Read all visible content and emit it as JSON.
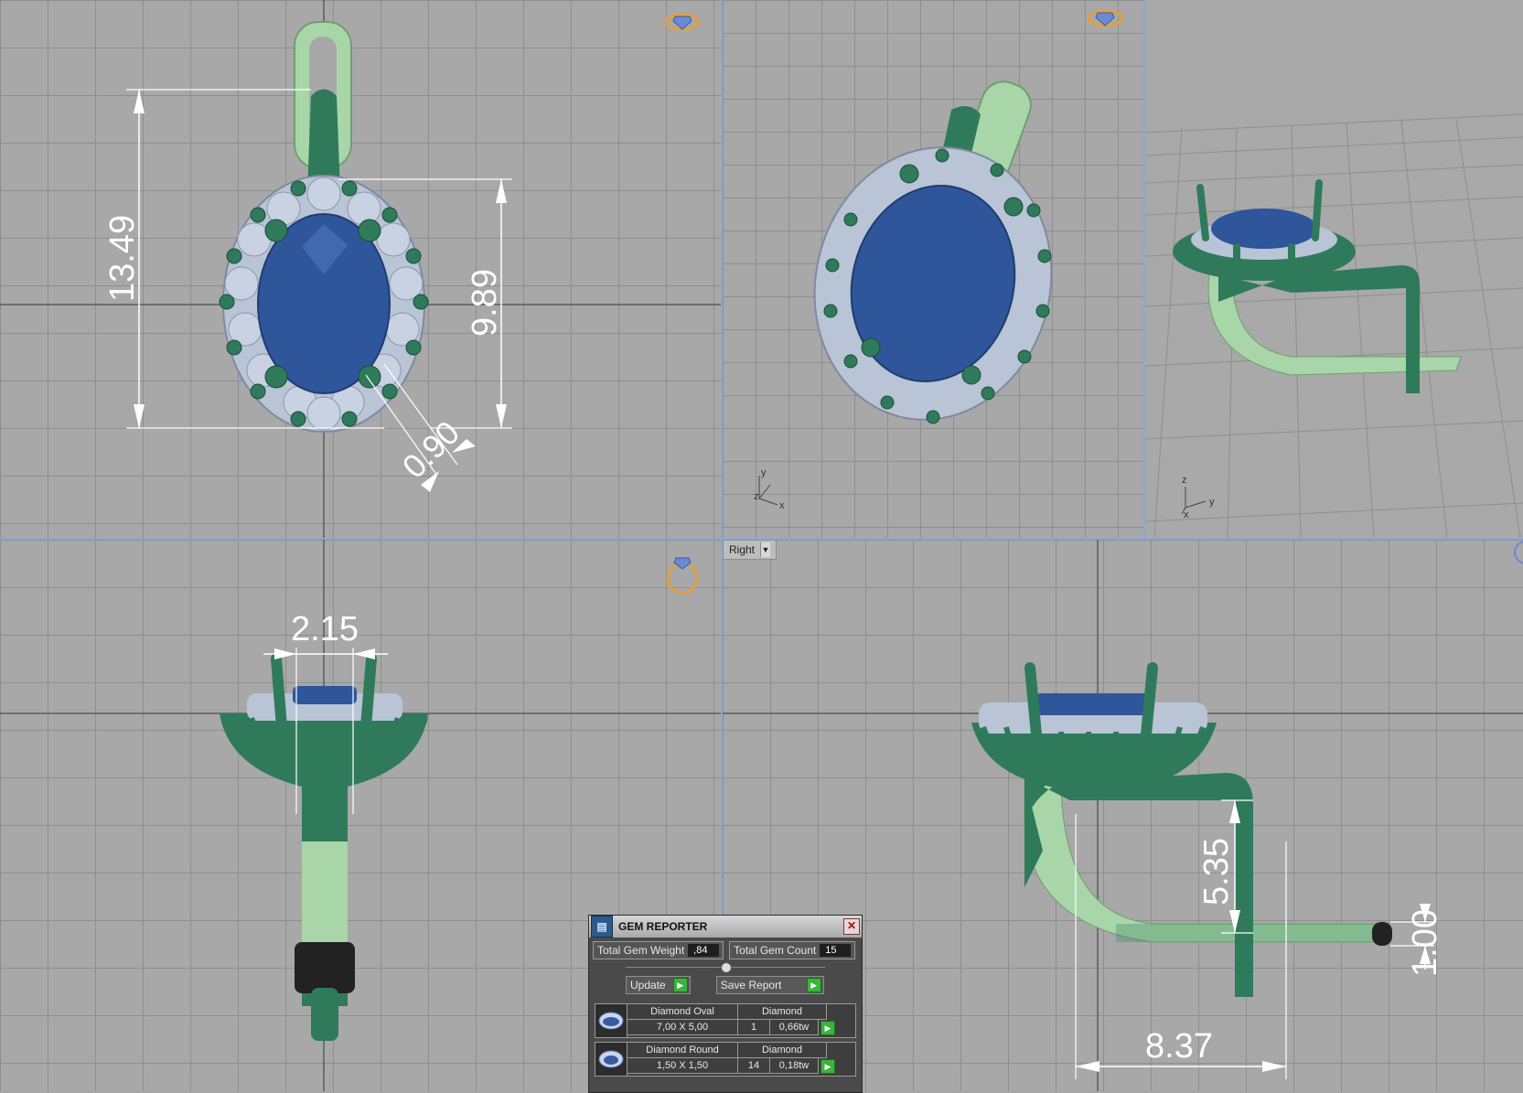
{
  "viewports": {
    "front": {
      "dims": {
        "height_total": "13.49",
        "stone_height": "9.89",
        "prong": "0.90"
      }
    },
    "perspective": {
      "axes": {
        "x": "x",
        "y": "y",
        "z": "z"
      }
    },
    "iso": {
      "axes": {
        "x": "x",
        "y": "y",
        "z": "z"
      }
    },
    "side": {
      "dims": {
        "prong_width": "2.15"
      }
    },
    "right": {
      "view_label": "Right",
      "dims": {
        "gap": "5.35",
        "thickness": "1.00",
        "length": "8.37"
      }
    }
  },
  "gem_reporter": {
    "title": "GEM REPORTER",
    "total_weight_label": "Total Gem Weight",
    "total_weight_value": ",84",
    "total_count_label": "Total Gem Count",
    "total_count_value": "15",
    "update_label": "Update",
    "save_label": "Save Report",
    "items": [
      {
        "name": "Diamond Oval",
        "material": "Diamond",
        "size": "7,00 X 5,00",
        "count": "1",
        "weight": "0,66tw"
      },
      {
        "name": "Diamond Round",
        "material": "Diamond",
        "size": "1,50 X 1,50",
        "count": "14",
        "weight": "0,18tw"
      }
    ]
  },
  "colors": {
    "metal_dark": "#2f7a5a",
    "metal_light": "#a8d6a8",
    "gem_blue": "#2f559a",
    "diamond": "#b9c4d6",
    "accent": "#8fa6d6"
  }
}
